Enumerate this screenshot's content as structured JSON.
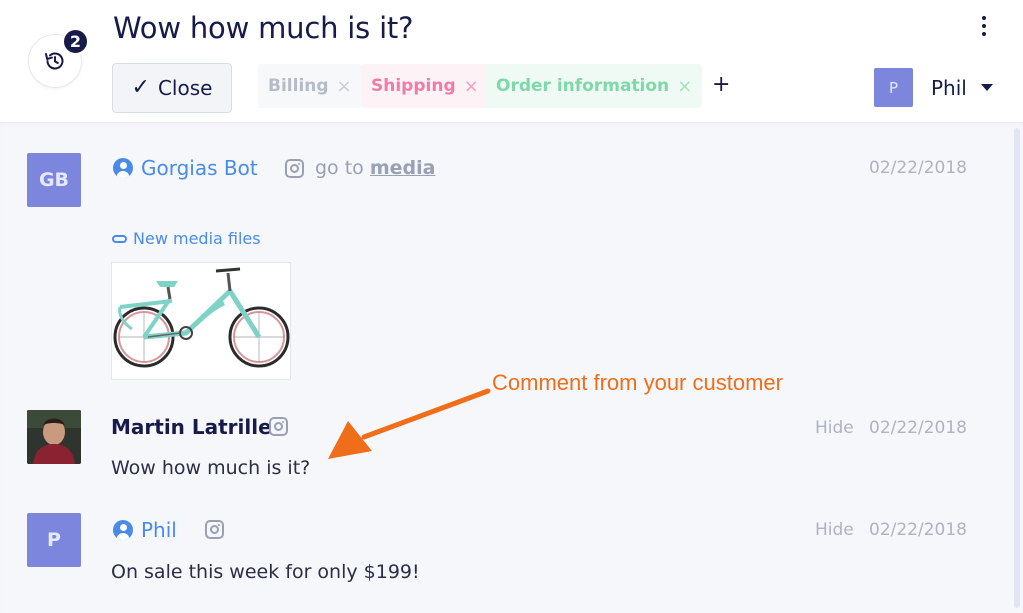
{
  "header": {
    "title": "Wow how much is it?",
    "history_count": "2",
    "close_label": "Close",
    "tags": [
      {
        "label": "Billing",
        "remove": "×"
      },
      {
        "label": "Shipping",
        "remove": "×"
      },
      {
        "label": "Order information",
        "remove": "×"
      }
    ],
    "add_tag": "+",
    "assignee": {
      "initial": "P",
      "name": "Phil"
    }
  },
  "messages": [
    {
      "avatar": "GB",
      "sender": "Gorgias Bot",
      "channel_icon": "instagram-icon",
      "action_prefix": "go to",
      "action_link": "media",
      "date": "02/22/2018",
      "media_label": "New media files",
      "media_description": "bicycle-photo"
    },
    {
      "sender": "Martin Latrille",
      "channel_icon": "instagram-icon",
      "hide": "Hide",
      "date": "02/22/2018",
      "body": "Wow how much is it?"
    },
    {
      "avatar": "P",
      "sender": "Phil",
      "channel_icon": "instagram-icon",
      "hide": "Hide",
      "date": "02/22/2018",
      "body": "On sale this week for only $199!"
    }
  ],
  "annotation": {
    "text": "Comment from your customer",
    "color": "#f06d1a"
  },
  "colors": {
    "accent": "#4a8be8",
    "navy": "#161b4a",
    "avatar": "#7b86dc"
  }
}
